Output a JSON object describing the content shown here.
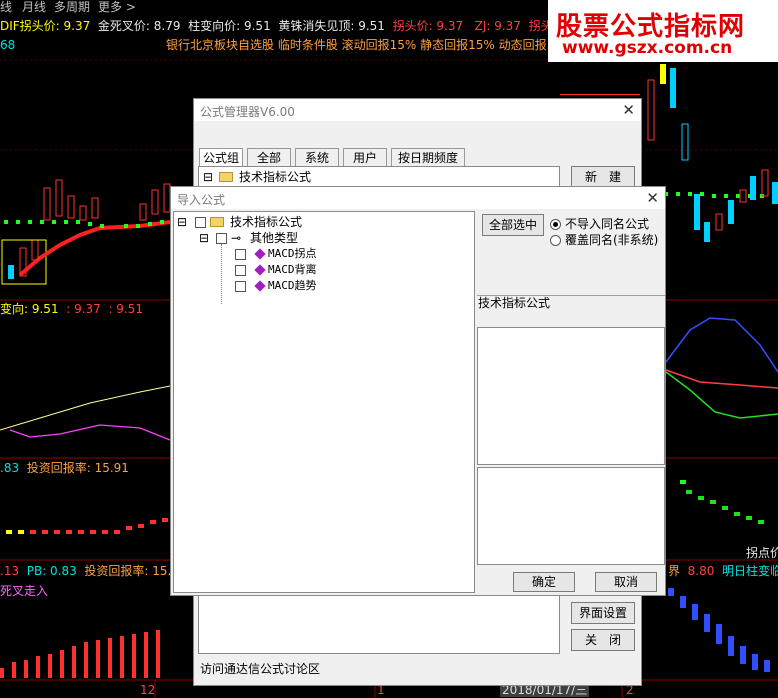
{
  "toolbar": {
    "items": [
      "线",
      "月线",
      "多周期",
      "更多 >"
    ]
  },
  "chart_top": {
    "line1": [
      "DIF拐头价: 9.37",
      "金死叉价: 8.79",
      "柱变向价: 9.51",
      "黄铢消失见顶: 9.51",
      "拐头价: 9.37",
      "ZJ: 9.37",
      "拐头价: 9.37"
    ],
    "left_value": "68",
    "line2": "银行北京板块自选股 临时条件股 滚动回报15% 静态回报15% 动态回报15"
  },
  "watermark": {
    "title": "股票公式指标网",
    "url": "www.gszx.com.cn"
  },
  "sub1_label": [
    "变向: 9.51",
    ": 9.37",
    ": 9.51"
  ],
  "sub2_label": [
    ".83",
    "投资回报率: 15.91"
  ],
  "sub3_label": [
    ".13",
    "PB: 0.83",
    "投资回报率: 15.9"
  ],
  "sub3_right": [
    "界",
    "8.80",
    "明日柱变临界"
  ],
  "sub4_label": "死叉走入",
  "right_note": "拐点价",
  "axis_labels": [
    "12",
    "1",
    "2018/01/17/三",
    "2"
  ],
  "formula_manager": {
    "title": "公式管理器V6.00",
    "tabs": [
      "公式组",
      "全部",
      "系统",
      "用户",
      "按日期频度"
    ],
    "tree_root": "技术指标公式",
    "buttons": [
      "新　建",
      "界面设置",
      "关　闭"
    ],
    "footer": "访问通达信公式讨论区"
  },
  "import_dialog": {
    "title": "导入公式",
    "select_all": "全部选中",
    "radio": [
      "不导入同名公式",
      "覆盖同名(非系统)"
    ],
    "tree": {
      "root": "技术指标公式",
      "group": "其他类型",
      "items": [
        "MACD拐点",
        "MACD背离",
        "MACD趋势"
      ]
    },
    "info_title": "技术指标公式",
    "ok": "确定",
    "cancel": "取消"
  }
}
